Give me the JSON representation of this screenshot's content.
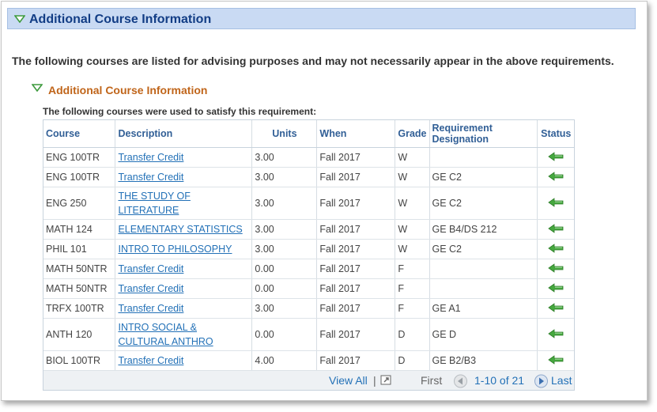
{
  "section": {
    "title": "Additional Course Information"
  },
  "advising_note": "The following courses are listed for advising purposes and may not necessarily appear in the above requirements.",
  "subsection": {
    "title": "Additional Course Information",
    "requirement_text": "The following courses were used to satisfy this requirement:"
  },
  "table": {
    "headers": {
      "course": "Course",
      "description": "Description",
      "units": "Units",
      "when": "When",
      "grade": "Grade",
      "requirement_designation_line1": "Requirement",
      "requirement_designation_line2": "Designation",
      "status": "Status"
    },
    "rows": [
      {
        "course": "ENG 100TR",
        "desc1": "Transfer Credit",
        "desc2": "",
        "units": "3.00",
        "when": "Fall 2017",
        "grade": "W",
        "req": ""
      },
      {
        "course": "ENG 100TR",
        "desc1": "Transfer Credit",
        "desc2": "",
        "units": "3.00",
        "when": "Fall 2017",
        "grade": "W",
        "req": "GE C2"
      },
      {
        "course": "ENG 250",
        "desc1": "THE STUDY OF",
        "desc2": "LITERATURE",
        "units": "3.00",
        "when": "Fall 2017",
        "grade": "W",
        "req": "GE C2"
      },
      {
        "course": "MATH 124",
        "desc1": "ELEMENTARY STATISTICS",
        "desc2": "",
        "units": "3.00",
        "when": "Fall 2017",
        "grade": "W",
        "req": "GE B4/DS 212"
      },
      {
        "course": "PHIL 101",
        "desc1": "INTRO TO PHILOSOPHY",
        "desc2": "",
        "units": "3.00",
        "when": "Fall 2017",
        "grade": "W",
        "req": "GE C2"
      },
      {
        "course": "MATH 50NTR",
        "desc1": "Transfer Credit",
        "desc2": "",
        "units": "0.00",
        "when": "Fall 2017",
        "grade": "F",
        "req": ""
      },
      {
        "course": "MATH 50NTR",
        "desc1": "Transfer Credit",
        "desc2": "",
        "units": "0.00",
        "when": "Fall 2017",
        "grade": "F",
        "req": ""
      },
      {
        "course": "TRFX 100TR",
        "desc1": "Transfer Credit",
        "desc2": "",
        "units": "3.00",
        "when": "Fall 2017",
        "grade": "F",
        "req": "GE A1"
      },
      {
        "course": "ANTH 120",
        "desc1": "INTRO SOCIAL &",
        "desc2": "CULTURAL ANTHRO",
        "units": "0.00",
        "when": "Fall 2017",
        "grade": "D",
        "req": "GE D"
      },
      {
        "course": "BIOL 100TR",
        "desc1": "Transfer Credit",
        "desc2": "",
        "units": "4.00",
        "when": "Fall 2017",
        "grade": "D",
        "req": "GE B2/B3"
      }
    ],
    "status_icon": "green-left-arrow-icon"
  },
  "navigation": {
    "view_all": "View All",
    "separator": "|",
    "first": "First",
    "range": "1-10 of 21",
    "last": "Last"
  },
  "colors": {
    "header_bg": "#c9daf3",
    "header_title": "#123d85",
    "subsection_title": "#c0651a",
    "link": "#2371b7",
    "arrow_green": "#3fa23c"
  }
}
